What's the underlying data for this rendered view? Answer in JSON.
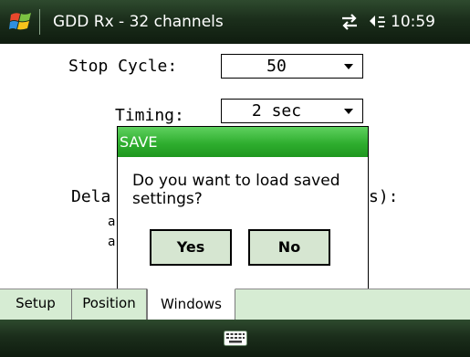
{
  "statusbar": {
    "title": "GDD Rx - 32 channels",
    "clock": "10:59",
    "icons": [
      "windows-start-icon",
      "sync-icon",
      "volume-icon"
    ]
  },
  "form": {
    "stop_cycle_label": "Stop Cycle:",
    "stop_cycle_value": "50",
    "timing_label": "Timing:",
    "timing_value": "2 sec",
    "obscured_label_left": "Dela",
    "obscured_label_right": "s):",
    "obscured_fragment_1": "a",
    "obscured_fragment_2": "a"
  },
  "dialog": {
    "title": "SAVE",
    "message": "Do you want to load saved settings?",
    "yes_label": "Yes",
    "no_label": "No"
  },
  "tabs": [
    {
      "label": "Setup",
      "selected": false
    },
    {
      "label": "Position",
      "selected": false
    },
    {
      "label": "Windows",
      "selected": true
    }
  ],
  "bottombar": {
    "icon": "keyboard-icon"
  },
  "colors": {
    "bar_dark": "#1b2e1b",
    "dialog_title_green": "#2fae2f",
    "button_fill": "#d6e6d1",
    "tab_strip": "#d6ecd3"
  }
}
